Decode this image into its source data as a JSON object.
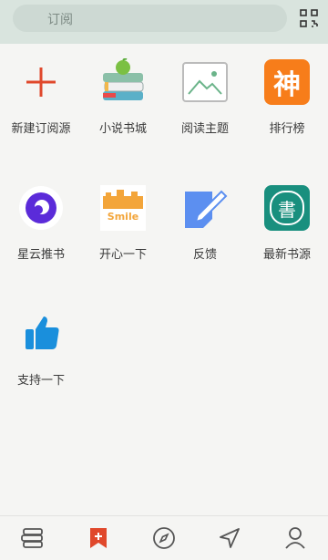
{
  "search": {
    "placeholder": "订阅"
  },
  "grid_items": [
    {
      "label": "新建订阅源",
      "icon": "add-icon"
    },
    {
      "label": "小说书城",
      "icon": "books-apple-icon"
    },
    {
      "label": "阅读主题",
      "icon": "image-theme-icon"
    },
    {
      "label": "排行榜",
      "icon": "shen-rank-icon",
      "glyph": "神"
    },
    {
      "label": "星云推书",
      "icon": "nebula-icon"
    },
    {
      "label": "开心一下",
      "icon": "smile-icon",
      "glyph": "Smile"
    },
    {
      "label": "反馈",
      "icon": "feedback-pencil-icon"
    },
    {
      "label": "最新书源",
      "icon": "book-source-icon",
      "glyph": "書"
    },
    {
      "label": "支持一下",
      "icon": "thumbs-up-icon"
    }
  ],
  "bottom_tabs": [
    {
      "icon": "bookshelf-icon",
      "active": false
    },
    {
      "icon": "bookmark-add-icon",
      "active": true
    },
    {
      "icon": "compass-icon",
      "active": false
    },
    {
      "icon": "navigation-icon",
      "active": false
    },
    {
      "icon": "profile-icon",
      "active": false
    }
  ],
  "colors": {
    "accent": "#e0482b",
    "topbar": "#d9e4de",
    "background": "#f5f5f3"
  }
}
